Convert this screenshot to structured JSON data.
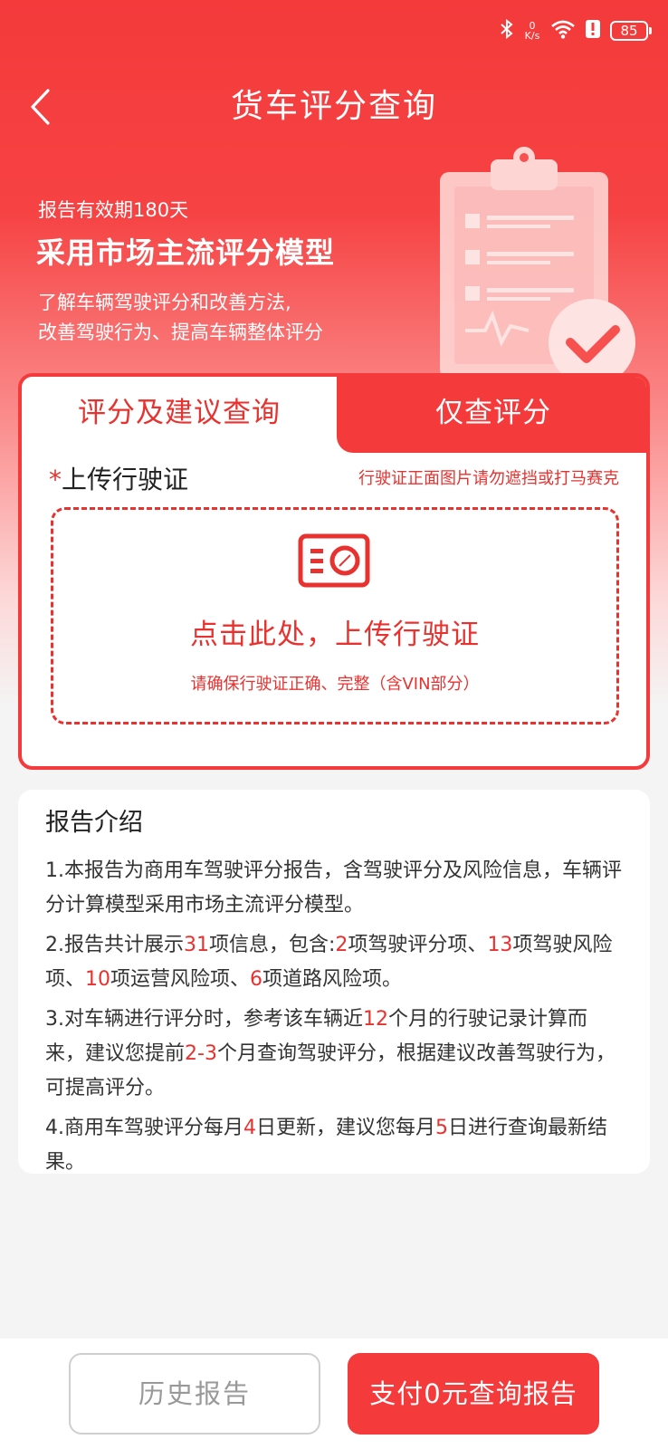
{
  "status_bar": {
    "net_speed_value": "0",
    "net_speed_unit": "K/s",
    "battery": "85"
  },
  "header": {
    "title": "货车评分查询"
  },
  "hero": {
    "validity": "报告有效期180天",
    "headline": "采用市场主流评分模型",
    "desc_line1": "了解车辆驾驶评分和改善方法,",
    "desc_line2": "改善驾驶行为、提高车辆整体评分"
  },
  "tabs": [
    {
      "label": "评分及建议查询",
      "active": true
    },
    {
      "label": "仅查评分",
      "active": false
    }
  ],
  "upload": {
    "required_mark": "*",
    "label": "上传行驶证",
    "warning": "行驶证正面图片请勿遮挡或打马赛克",
    "cta": "点击此处，上传行驶证",
    "tip": "请确保行驶证正确、完整（含VIN部分）"
  },
  "intro": {
    "title": "报告介绍",
    "p1": "1.本报告为商用车驾驶评分报告，含驾驶评分及风险信息，车辆评分计算模型采用市场主流评分模型。",
    "p2": {
      "a": "2.报告共计展示",
      "b": "31",
      "c": "项信息，包含:",
      "d": "2",
      "e": "项驾驶评分项、",
      "f": "13",
      "g": "项驾驶风险项、",
      "h": "10",
      "i": "项运营风险项、",
      "j": "6",
      "k": "项道路风险项。"
    },
    "p3": {
      "a": "3.对车辆进行评分时，参考该车辆近",
      "b": "12",
      "c": "个月的行驶记录计算而来，建议您提前",
      "d": "2-3",
      "e": "个月查询驾驶评分，根据建议改善驾驶行为，可提高评分。"
    },
    "p4": {
      "a": "4.商用车驾驶评分每月",
      "b": "4",
      "c": "日更新，建议您每月",
      "d": "5",
      "e": "日进行查询最新结果。"
    }
  },
  "footer": {
    "history_label": "历史报告",
    "pay_label": "支付0元查询报告"
  },
  "colors": {
    "brand_red": "#f43a3b",
    "accent_red": "#e8322f"
  },
  "icons": [
    "bluetooth-icon",
    "wifi-icon",
    "alert-icon",
    "battery-icon",
    "back-arrow-icon",
    "clipboard-illustration",
    "driving-license-icon"
  ]
}
